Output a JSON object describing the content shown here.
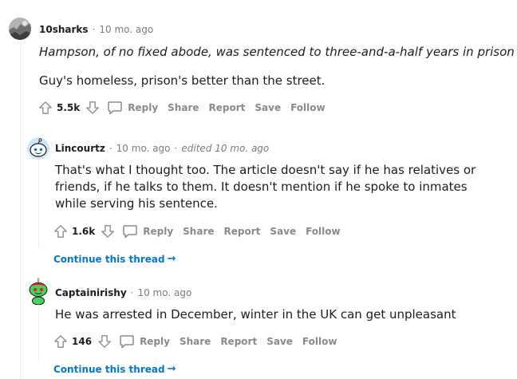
{
  "comments": [
    {
      "username": "10sharks",
      "time": "10 mo. ago",
      "quote": "Hampson, of no fixed abode, was sentenced to three-and-a-half years in prison",
      "body": "Guy's homeless, prison's better than the street.",
      "votes": "5.5k"
    },
    {
      "username": "Lincourtz",
      "time": "10 mo. ago",
      "edited": "edited 10 mo. ago",
      "body": "That's what I thought too. The article doesn't say if he has relatives or friends, if he talks to them. It doesn't mention if he spoke to inmates while serving his sentence.",
      "votes": "1.6k"
    },
    {
      "username": "Captainirishy",
      "time": "10 mo. ago",
      "body": "He was arrested in December, winter in the UK can get unpleasant",
      "votes": "146"
    }
  ],
  "actions": {
    "reply": "Reply",
    "share": "Share",
    "report": "Report",
    "save": "Save",
    "follow": "Follow"
  },
  "separator": "·",
  "continue_thread": "Continue this thread",
  "continue_arrow": "→",
  "colors": {
    "meta_gray": "#7c7c7c",
    "action_gray": "#878a8c",
    "link_blue": "#0079d3",
    "thread_line": "#edeff1"
  },
  "icons": [
    "upvote-icon",
    "downvote-icon",
    "comment-icon",
    "arrow-right-icon"
  ]
}
